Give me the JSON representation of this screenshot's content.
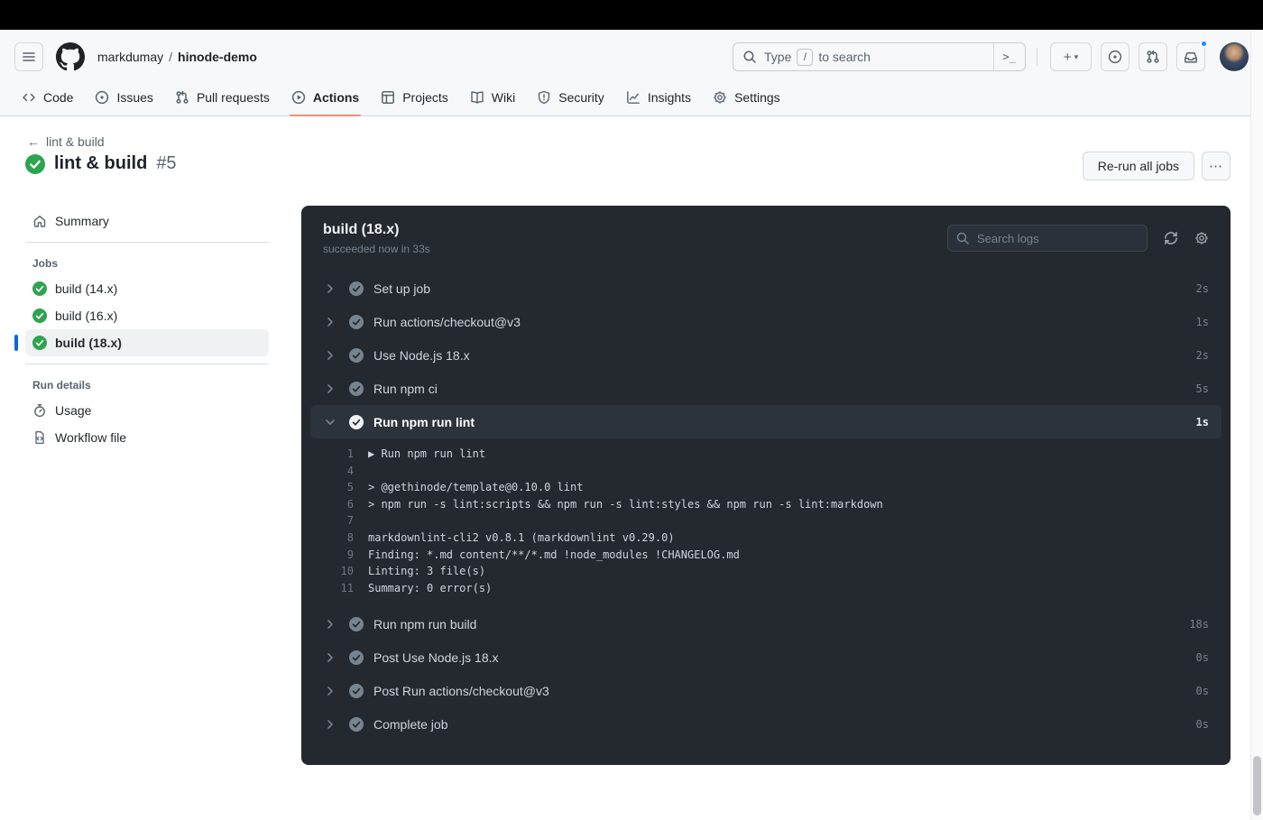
{
  "glyphs": {
    "back_arrow": "←",
    "kebab": "⋯",
    "plus": "+",
    "caret": "▾",
    "terminal_prompt": ">_"
  },
  "header": {
    "repo_owner": "markdumay",
    "separator": "/",
    "repo_name": "hinode-demo",
    "search": {
      "prefix": "Type",
      "key": "/",
      "suffix": "to search"
    },
    "nav": [
      {
        "label": "Code"
      },
      {
        "label": "Issues"
      },
      {
        "label": "Pull requests"
      },
      {
        "label": "Actions"
      },
      {
        "label": "Projects"
      },
      {
        "label": "Wiki"
      },
      {
        "label": "Security"
      },
      {
        "label": "Insights"
      },
      {
        "label": "Settings"
      }
    ]
  },
  "run": {
    "back_label": "lint & build",
    "title": "lint & build",
    "number": "#5",
    "rerun_button": "Re-run all jobs"
  },
  "sidebar": {
    "summary": "Summary",
    "jobs_heading": "Jobs",
    "jobs": [
      {
        "label": "build (14.x)"
      },
      {
        "label": "build (16.x)"
      },
      {
        "label": "build (18.x)"
      }
    ],
    "run_details_heading": "Run details",
    "usage": "Usage",
    "workflow_file": "Workflow file"
  },
  "panel": {
    "title": "build (18.x)",
    "status": "succeeded now in 33s",
    "search_placeholder": "Search logs",
    "steps": [
      {
        "name": "Set up job",
        "duration": "2s"
      },
      {
        "name": "Run actions/checkout@v3",
        "duration": "1s"
      },
      {
        "name": "Use Node.js 18.x",
        "duration": "2s"
      },
      {
        "name": "Run npm ci",
        "duration": "5s"
      },
      {
        "name": "Run npm run lint",
        "duration": "1s"
      },
      {
        "name": "Run npm run build",
        "duration": "18s"
      },
      {
        "name": "Post Use Node.js 18.x",
        "duration": "0s"
      },
      {
        "name": "Post Run actions/checkout@v3",
        "duration": "0s"
      },
      {
        "name": "Complete job",
        "duration": "0s"
      }
    ],
    "log": [
      {
        "num": "1",
        "text": "▶ Run npm run lint"
      },
      {
        "num": "4",
        "text": ""
      },
      {
        "num": "5",
        "text": "> @gethinode/template@0.10.0 lint"
      },
      {
        "num": "6",
        "text": "> npm run -s lint:scripts && npm run -s lint:styles && npm run -s lint:markdown"
      },
      {
        "num": "7",
        "text": ""
      },
      {
        "num": "8",
        "text": "markdownlint-cli2 v0.8.1 (markdownlint v0.29.0)"
      },
      {
        "num": "9",
        "text": "Finding: *.md content/**/*.md !node_modules !CHANGELOG.md"
      },
      {
        "num": "10",
        "text": "Linting: 3 file(s)"
      },
      {
        "num": "11",
        "text": "Summary: 0 error(s)"
      }
    ]
  },
  "colors": {
    "accent_blue": "#0969da",
    "success_green": "#2da44e",
    "tab_underline": "#fd8c73",
    "panel_bg": "#24292f",
    "panel_row_highlight": "#2d333b",
    "notification_dot": "#218bff"
  }
}
